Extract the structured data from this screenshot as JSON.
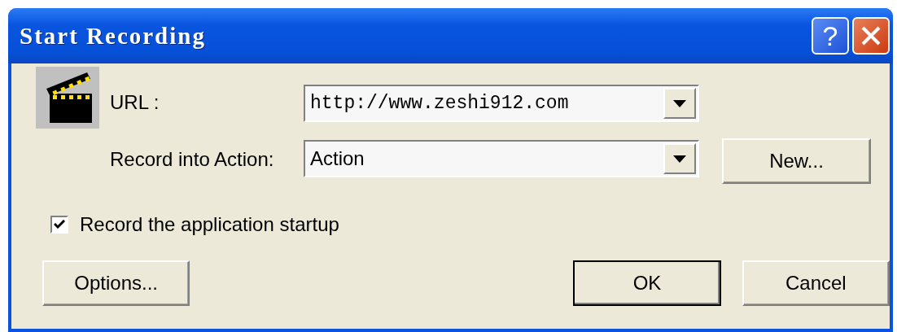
{
  "window": {
    "title": "Start Recording",
    "title_buttons": [
      {
        "kind": "help",
        "label": "?"
      },
      {
        "kind": "close"
      }
    ]
  },
  "fields": [
    {
      "label": "URL :",
      "value": "http://www.zeshi912.com",
      "mono": true
    },
    {
      "label": "Record into Action:",
      "value": "Action",
      "mono": false
    }
  ],
  "new_button": "New...",
  "startup": {
    "label": "Record the application startup",
    "checked": true
  },
  "buttons": [
    {
      "label": "Options...",
      "default": false
    },
    {
      "label": "OK",
      "default": true
    },
    {
      "label": "Cancel",
      "default": false
    }
  ]
}
